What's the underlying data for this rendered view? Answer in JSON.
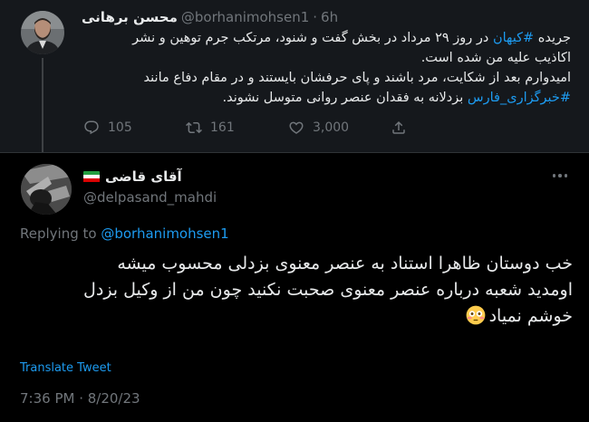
{
  "parent_tweet": {
    "display_name": "محسن برهانی",
    "handle": "@borhanimohsen1",
    "time": "6h",
    "body_lines": [
      {
        "pre": "جریده ",
        "hashtag": "#کیهان",
        "post": " در روز ۲۹ مرداد در بخش گفت و شنود، مرتکب جرم توهین و نشر"
      },
      {
        "pre": "اکاذیب علیه من شده است.",
        "hashtag": "",
        "post": ""
      },
      {
        "pre": "امیدوارم بعد از شکایت، مرد باشند و پای حرفشان بایستند و در مقام دفاع مانند",
        "hashtag": "",
        "post": ""
      },
      {
        "pre": "",
        "hashtag": "#خبرگزاری_فارس",
        "post": " بزدلانه به فقدان عنصر روانی متوسل نشوند."
      }
    ],
    "replies": "105",
    "retweets": "161",
    "likes": "3,000"
  },
  "reply_tweet": {
    "display_name": "آقای قاضی",
    "handle": "@delpasand_mahdi",
    "replying_prefix": "Replying to ",
    "replying_to": "@borhanimohsen1",
    "body_lines": [
      "خب دوستان ظاهرا استناد به عنصر معنوی بزدلی محسوب میشه",
      "اومدید شعبه درباره عنصر معنوی صحبت نکنید چون من از وکیل بزدل",
      "خوشم نمیاد"
    ],
    "translate_label": "Translate Tweet",
    "timestamp": "7:36 PM · 8/20/23"
  },
  "colors": {
    "background": "#000000",
    "parent_background": "#15181c",
    "text": "#e7e9ea",
    "secondary": "#71767b",
    "link": "#1d9bf0"
  },
  "icons": [
    "reply-icon",
    "retweet-icon",
    "like-icon",
    "share-icon",
    "more-icon",
    "iran-flag-icon",
    "flushed-face-emoji"
  ]
}
